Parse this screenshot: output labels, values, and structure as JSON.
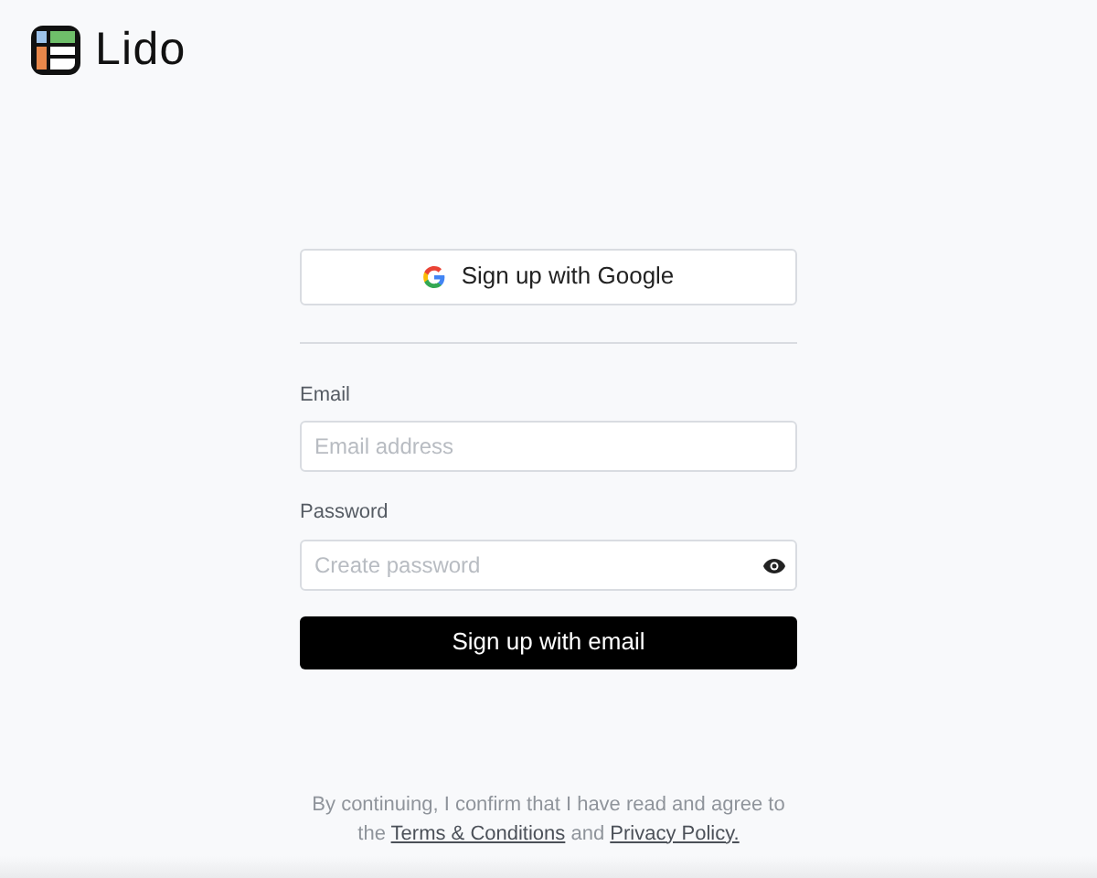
{
  "brand": {
    "name": "Lido"
  },
  "google_button": {
    "label": "Sign up with Google"
  },
  "fields": [
    {
      "label": "Email",
      "placeholder": "Email address",
      "kind": "text"
    },
    {
      "label": "Password",
      "placeholder": "Create password",
      "kind": "password"
    }
  ],
  "submit_button": {
    "label": "Sign up with email"
  },
  "legal": {
    "text_1": "By continuing, I confirm that I have read and agree to the",
    "link_1": "Terms & Conditions",
    "text_2": "and",
    "link_2": "Privacy Policy."
  }
}
